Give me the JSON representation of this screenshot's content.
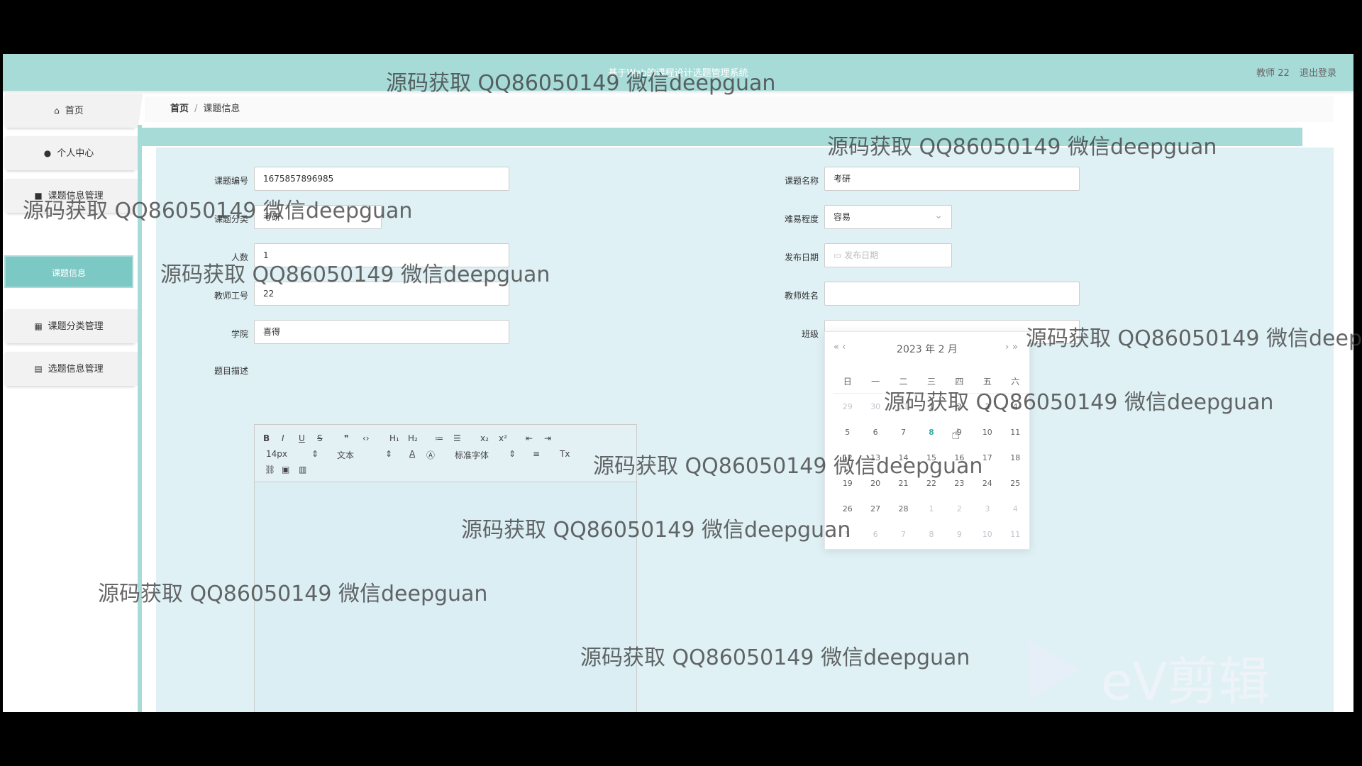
{
  "header": {
    "app_title": "基于Web的课程设计选题管理系统",
    "user": "教师 22",
    "logout": "退出登录"
  },
  "sidebar": {
    "items": [
      {
        "label": "首页",
        "icon": "home-icon"
      },
      {
        "label": "个人中心",
        "icon": "user-icon"
      },
      {
        "label": "课题信息管理",
        "icon": "book-icon"
      },
      {
        "label": "课题分类管理",
        "icon": "grid-icon"
      },
      {
        "label": "选题信息管理",
        "icon": "clipboard-icon"
      }
    ],
    "sub_item": "课题信息"
  },
  "breadcrumb": {
    "home": "首页",
    "separator": "/",
    "current": "课题信息"
  },
  "form": {
    "topic_no_label": "课题编号",
    "topic_no": "1675857896985",
    "topic_name_label": "课题名称",
    "topic_name": "考研",
    "category_label": "课题分类",
    "category": "考研",
    "difficulty_label": "难易程度",
    "difficulty": "容易",
    "count_label": "人数",
    "count": "1",
    "publish_date_label": "发布日期",
    "publish_date_placeholder": "发布日期",
    "teacher_no_label": "教师工号",
    "teacher_no": "22",
    "teacher_name_label": "教师姓名",
    "teacher_name": "",
    "college_label": "学院",
    "college": "喜得",
    "class_label": "班级",
    "class": "",
    "desc_label": "题目描述"
  },
  "editor_toolbar": {
    "font_size": "14px",
    "text_type": "文本",
    "font_family": "标准字体"
  },
  "calendar": {
    "title": "2023 年 2 月",
    "weekdays": [
      "日",
      "一",
      "二",
      "三",
      "四",
      "五",
      "六"
    ],
    "weeks": [
      [
        "29",
        "30",
        "31",
        "1",
        "2",
        "3",
        "4"
      ],
      [
        "5",
        "6",
        "7",
        "8",
        "9",
        "10",
        "11"
      ],
      [
        "12",
        "13",
        "14",
        "15",
        "16",
        "17",
        "18"
      ],
      [
        "19",
        "20",
        "21",
        "22",
        "23",
        "24",
        "25"
      ],
      [
        "26",
        "27",
        "28",
        "1",
        "2",
        "3",
        "4"
      ],
      [
        "5",
        "6",
        "7",
        "8",
        "9",
        "10",
        "11"
      ]
    ],
    "today": "8"
  },
  "watermark": "源码获取 QQ86050149 微信deepguan",
  "brand": "eV剪辑"
}
